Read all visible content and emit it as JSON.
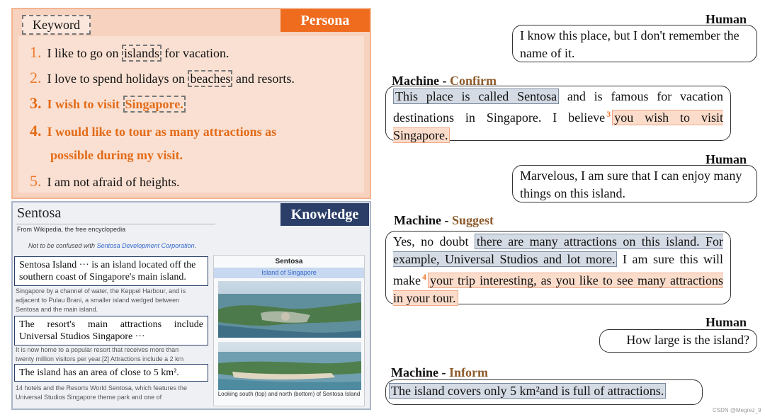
{
  "persona": {
    "keyword_label": "Keyword",
    "tag": "Persona",
    "items": [
      {
        "num": "1.",
        "pre": "I like to go on ",
        "kw": "islands",
        "post": " for vacation."
      },
      {
        "num": "2.",
        "pre": "I love to spend holidays on ",
        "kw": "beaches",
        "post": " and resorts."
      },
      {
        "num": "3.",
        "pre": "I wish to visit ",
        "kw": "Singapore.",
        "post": ""
      },
      {
        "num": "4.",
        "line1": "I would like to tour as many attractions as",
        "line2": "possible during my visit."
      },
      {
        "num": "5.",
        "text": "I am not afraid of heights."
      }
    ]
  },
  "knowledge": {
    "tag": "Knowledge",
    "wiki_title": "Sentosa",
    "from_wiki": "From Wikipedia, the free encyclopedia",
    "not_confused_pre": "Not to be confused with ",
    "not_confused_link": "Sentosa Development Corporation",
    "not_confused_post": ".",
    "boxes": [
      "Sentosa Island ··· is an island located off the southern coast of Singapore's main island.",
      "The resort's main attractions include Universal Studios Singapore ···",
      "The island has an area of close to 5 km²."
    ],
    "bg_lines": [
      "Singapore by a channel of water, the Keppel Harbour, and is",
      "adjacent to Pulau Brani, a smaller island wedged between",
      "Sentosa and the main island.",
      "It is now home to a popular resort that receives more than",
      "twenty million visitors per year.[2] Attractions include a 2 km",
      "14 hotels and the Resorts World Sentosa, which features the",
      "Universal Studios Singapore theme park and one of"
    ],
    "infobox_title": "Sentosa",
    "infobox_sub": "Island of Singapore",
    "caption": "Looking south (top) and north (bottom) of Sentosa Island"
  },
  "dialogue": {
    "human1_label": "Human",
    "human1_text": "I know this place, but I don't remember the name of it.",
    "m1_label": "Machine - ",
    "m1_act": "Confirm",
    "m1_hl1": "This place is called Sentosa",
    "m1_mid": " and is famous for vacation destinations in Singapore. I believe",
    "m1_sup": "3",
    "m1_hl2": "you wish to visit Singapore.",
    "human2_label": "Human",
    "human2_text": "Marvelous, I am sure that I can enjoy many things on this island.",
    "m2_label": "Machine - ",
    "m2_act": "Suggest",
    "m2_pre": "Yes, no doubt ",
    "m2_hl1": "there are many attractions on this island. For example, Universal Studios and lot more.",
    "m2_mid": " I am sure this will make",
    "m2_sup": "4",
    "m2_hl2": "your trip interesting, as you like to see many attractions in your tour.",
    "human3_label": "Human",
    "human3_text": "How large is the island?",
    "m3_label": "Machine - ",
    "m3_act": "Inform",
    "m3_hl": "The island covers only 5 km²and is full of attractions."
  },
  "watermark": "CSDN @Megrez_9",
  "colors": {
    "persona_accent": "#ef6b1e",
    "knowledge_accent": "#2a3e67",
    "act_color": "#8c5a2b"
  }
}
